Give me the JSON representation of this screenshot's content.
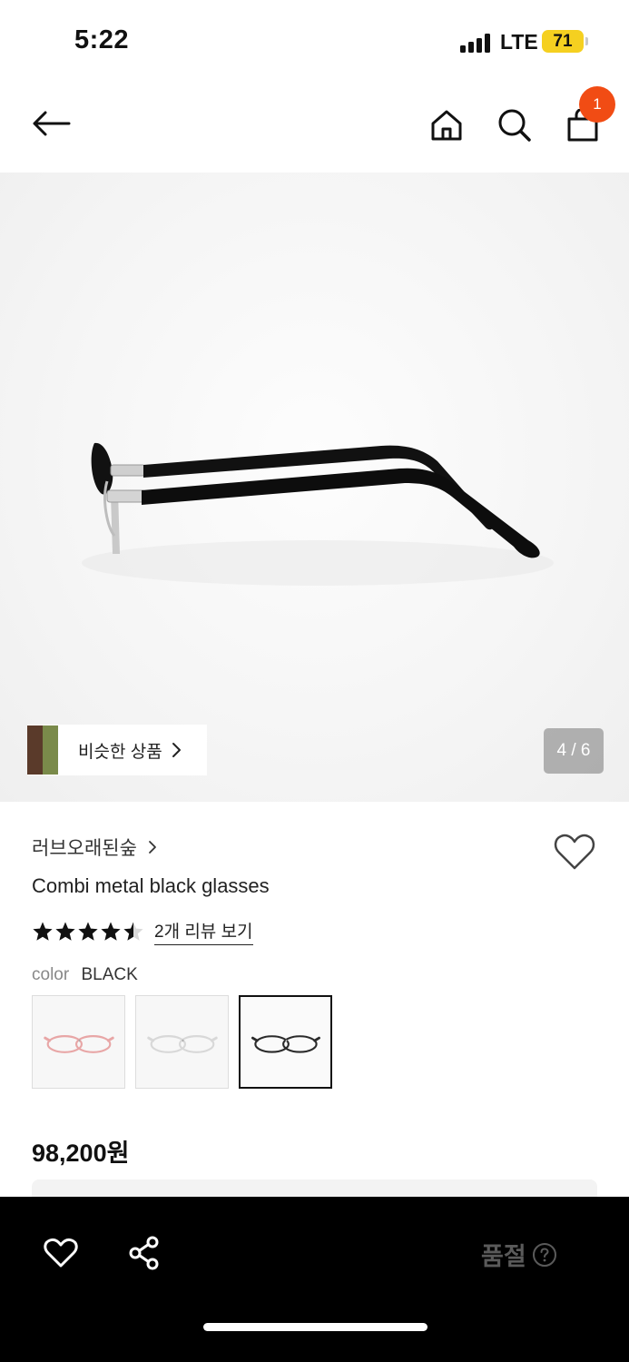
{
  "status_bar": {
    "time": "5:22",
    "network": "LTE",
    "battery": "71"
  },
  "nav": {
    "cart_count": "1",
    "icons": [
      "back-arrow-icon",
      "home-icon",
      "search-icon",
      "shopping-bag-icon"
    ]
  },
  "gallery": {
    "similar_label": "비슷한 상품",
    "page_indicator": "4 / 6"
  },
  "product": {
    "brand": "러브오래된숲",
    "title": "Combi metal black glasses",
    "rating": 4.5,
    "review_link": "2개 리뷰 보기",
    "color_label": "color",
    "color_value": "BLACK",
    "swatches": [
      {
        "name": "pink",
        "color": "#e8a6a6",
        "selected": false
      },
      {
        "name": "clear",
        "color": "#d8d8d8",
        "selected": false
      },
      {
        "name": "black",
        "color": "#2a2a2a",
        "selected": true
      }
    ],
    "price": "98,200원"
  },
  "bottom_bar": {
    "soldout_label": "품절",
    "icons": [
      "heart-icon",
      "share-icon",
      "help-circle-icon"
    ]
  },
  "colors": {
    "badge": "#f14c14",
    "battery": "#f5d020",
    "bottom_bar": "#000000",
    "soldout_text": "#5a5a5a"
  }
}
